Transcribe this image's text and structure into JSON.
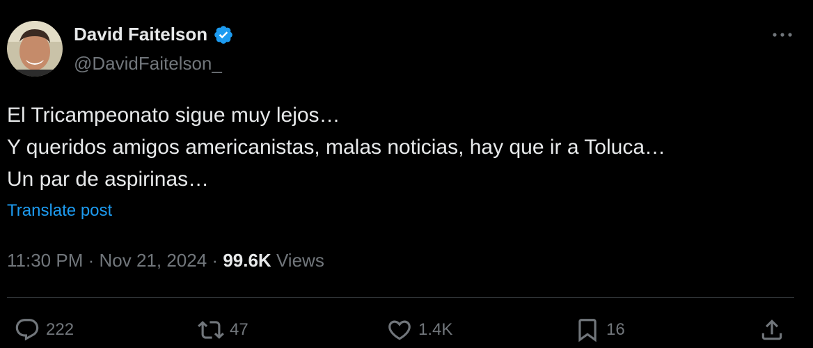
{
  "author": {
    "display_name": "David Faitelson",
    "handle": "@DavidFaitelson_",
    "verified": true,
    "verified_color": "#1d9bf0"
  },
  "post": {
    "lines": [
      "El Tricampeonato sigue muy lejos…",
      "Y queridos amigos americanistas, malas noticias, hay que ir a Toluca…",
      "Un par de aspirinas…"
    ],
    "translate_label": "Translate post"
  },
  "meta": {
    "time": "11:30 PM",
    "separator": "·",
    "date": "Nov 21, 2024",
    "views_count": "99.6K",
    "views_label": "Views"
  },
  "actions": {
    "replies": {
      "icon": "reply-icon",
      "count": "222"
    },
    "reposts": {
      "icon": "repost-icon",
      "count": "47"
    },
    "likes": {
      "icon": "heart-icon",
      "count": "1.4K"
    },
    "bookmarks": {
      "icon": "bookmark-icon",
      "count": "16"
    },
    "share": {
      "icon": "share-icon"
    }
  },
  "colors": {
    "background": "#000000",
    "primary_text": "#e7e9ea",
    "secondary_text": "#71767b",
    "link": "#1d9bf0",
    "divider": "#2f3336"
  }
}
